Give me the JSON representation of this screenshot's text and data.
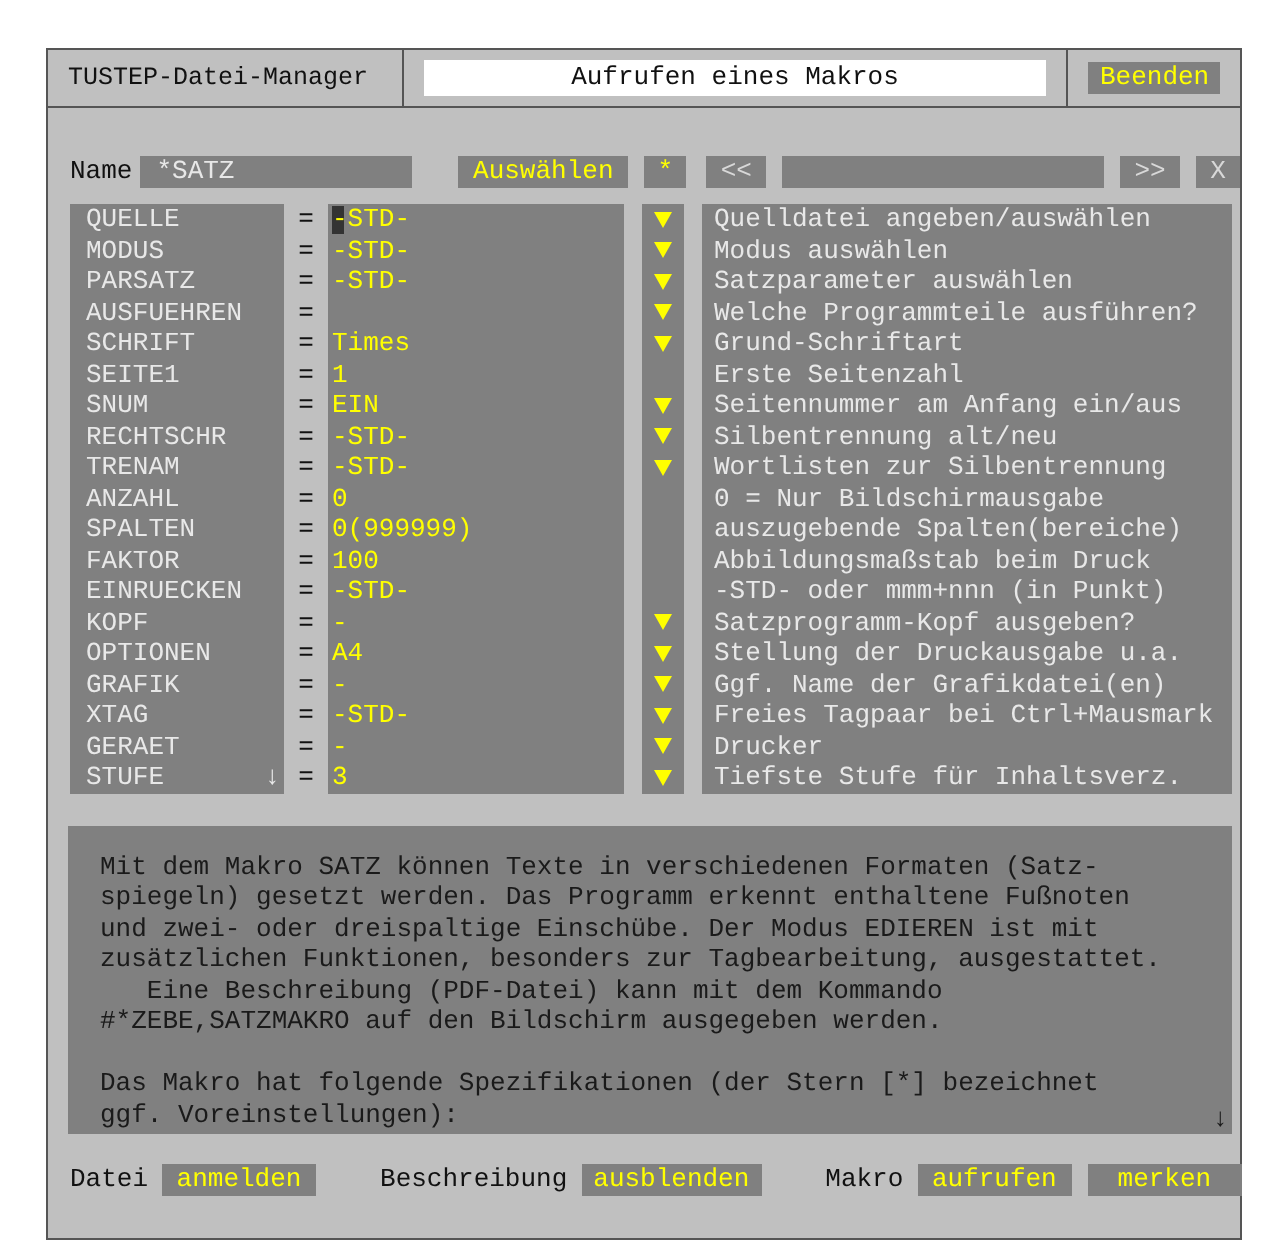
{
  "window": {
    "title": "TUSTEP-Datei-Manager",
    "heading": "Aufrufen eines Makros",
    "close_button": "Beenden"
  },
  "name_row": {
    "label": "Name",
    "value": "*SATZ",
    "select_button": "Auswählen",
    "star_button": "*",
    "prev_button": "<<",
    "next_button": ">>",
    "clear_button": "X"
  },
  "parameters": [
    {
      "name": "QUELLE",
      "sep": "=",
      "value": "-STD-",
      "dropdown": true,
      "cursor": true,
      "description": "Quelldatei angeben/auswählen"
    },
    {
      "name": "MODUS",
      "sep": "=",
      "value": "-STD-",
      "dropdown": true,
      "cursor": false,
      "description": "Modus auswählen"
    },
    {
      "name": "PARSATZ",
      "sep": "=",
      "value": "-STD-",
      "dropdown": true,
      "cursor": false,
      "description": "Satzparameter auswählen"
    },
    {
      "name": "AUSFUEHREN",
      "sep": "=",
      "dropdown": true,
      "cursor": false,
      "description": "Welche Programmteile ausführen?"
    },
    {
      "name": "SCHRIFT",
      "sep": "=",
      "value": "Times",
      "dropdown": true,
      "cursor": false,
      "description": "Grund-Schriftart"
    },
    {
      "name": "SEITE1",
      "sep": "=",
      "value": "1",
      "dropdown": false,
      "cursor": false,
      "description": "Erste Seitenzahl"
    },
    {
      "name": "SNUM",
      "sep": "=",
      "value": "EIN",
      "dropdown": true,
      "cursor": false,
      "description": "Seitennummer am Anfang ein/aus"
    },
    {
      "name": "RECHTSCHR",
      "sep": "=",
      "value": "-STD-",
      "dropdown": true,
      "cursor": false,
      "description": "Silbentrennung alt/neu"
    },
    {
      "name": "TRENAM",
      "sep": "=",
      "value": "-STD-",
      "dropdown": true,
      "cursor": false,
      "description": "Wortlisten zur Silbentrennung"
    },
    {
      "name": "ANZAHL",
      "sep": "=",
      "value": "0",
      "dropdown": false,
      "cursor": false,
      "description": "0 = Nur Bildschirmausgabe"
    },
    {
      "name": "SPALTEN",
      "sep": "=",
      "value": "0(999999)",
      "dropdown": false,
      "cursor": false,
      "description": "auszugebende Spalten(bereiche)"
    },
    {
      "name": "FAKTOR",
      "sep": "=",
      "value": "100",
      "dropdown": false,
      "cursor": false,
      "description": "Abbildungsmaßstab beim Druck"
    },
    {
      "name": "EINRUECKEN",
      "sep": "=",
      "value": "-STD-",
      "dropdown": false,
      "cursor": false,
      "description": "-STD- oder mmm+nnn (in Punkt)"
    },
    {
      "name": "KOPF",
      "sep": "=",
      "value": "-",
      "dropdown": true,
      "cursor": false,
      "description": "Satzprogramm-Kopf ausgeben?"
    },
    {
      "name": "OPTIONEN",
      "sep": "=",
      "value": "A4",
      "dropdown": true,
      "cursor": false,
      "description": "Stellung der Druckausgabe u.a."
    },
    {
      "name": "GRAFIK",
      "sep": "=",
      "value": "-",
      "dropdown": true,
      "cursor": false,
      "description": "Ggf. Name der Grafikdatei(en)"
    },
    {
      "name": "XTAG",
      "sep": "=",
      "value": "-STD-",
      "dropdown": true,
      "cursor": false,
      "description": "Freies Tagpaar bei Ctrl+Mausmark"
    },
    {
      "name": "GERAET",
      "sep": "=",
      "value": "-",
      "dropdown": true,
      "cursor": false,
      "description": "Drucker"
    },
    {
      "name": "STUFE",
      "sep": "=",
      "value": "3",
      "dropdown": true,
      "cursor": false,
      "scroll_mark": "↓",
      "description": "Tiefste Stufe für Inhaltsverz."
    }
  ],
  "description_box": {
    "paragraphs": [
      [
        "Mit dem Makro SATZ können Texte in verschiedenen Formaten (Satz-",
        "spiegeln) gesetzt werden. Das Programm erkennt enthaltene Fußnoten",
        "und zwei- oder dreispaltige Einschübe. Der Modus EDIEREN ist mit",
        "zusätzlichen Funktionen, besonders zur Tagbearbeitung, ausgestattet.",
        "   Eine Beschreibung (PDF-Datei) kann mit dem Kommando",
        "#*ZEBE,SATZMAKRO auf den Bildschirm ausgegeben werden."
      ],
      [
        "Das Makro hat folgende Spezifikationen (der Stern [*] bezeichnet",
        "ggf. Voreinstellungen):"
      ]
    ],
    "scroll_mark": "↓"
  },
  "footer": [
    {
      "label": "Datei",
      "button": "anmelden"
    },
    {
      "label": "Beschreibung",
      "button": "ausblenden"
    },
    {
      "label": "Makro",
      "button": "aufrufen"
    },
    {
      "button": "merken"
    }
  ]
}
